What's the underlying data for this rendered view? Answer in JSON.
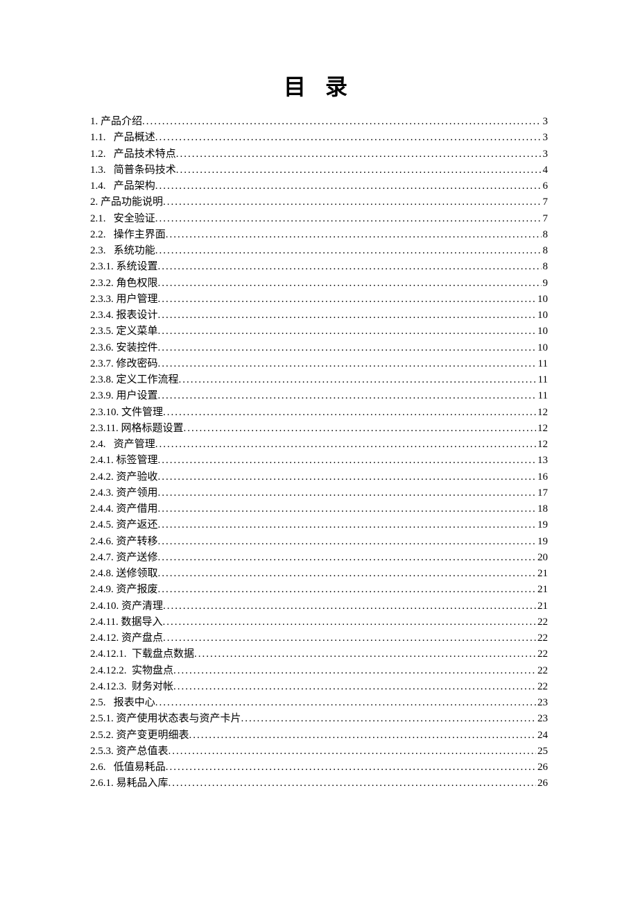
{
  "title": "目 录",
  "entries": [
    {
      "num": "1.",
      "text": "产品介绍",
      "page": "3",
      "indent": 0,
      "gap": " "
    },
    {
      "num": "1.1.",
      "text": "产品概述",
      "page": "3",
      "indent": 1,
      "gap": "   "
    },
    {
      "num": "1.2.",
      "text": "产品技术特点",
      "page": "3",
      "indent": 1,
      "gap": "   "
    },
    {
      "num": "1.3.",
      "text": "简普条码技术",
      "page": "4",
      "indent": 1,
      "gap": "   "
    },
    {
      "num": "1.4.",
      "text": "产品架构",
      "page": "6",
      "indent": 1,
      "gap": "   "
    },
    {
      "num": "2.",
      "text": "产品功能说明",
      "page": "7",
      "indent": 0,
      "gap": " "
    },
    {
      "num": "2.1.",
      "text": "安全验证",
      "page": "7",
      "indent": 1,
      "gap": "   "
    },
    {
      "num": "2.2.",
      "text": "操作主界面",
      "page": "8",
      "indent": 1,
      "gap": "   "
    },
    {
      "num": "2.3.",
      "text": "系统功能",
      "page": "8",
      "indent": 1,
      "gap": "   "
    },
    {
      "num": "2.3.1.",
      "text": "系统设置 ",
      "page": "8",
      "indent": 2,
      "gap": " "
    },
    {
      "num": "2.3.2.",
      "text": "角色权限 ",
      "page": "9",
      "indent": 2,
      "gap": " "
    },
    {
      "num": "2.3.3.",
      "text": "用户管理 ",
      "page": "10",
      "indent": 2,
      "gap": " "
    },
    {
      "num": "2.3.4.",
      "text": "报表设计 ",
      "page": "10",
      "indent": 2,
      "gap": " "
    },
    {
      "num": "2.3.5.",
      "text": "定义菜单 ",
      "page": "10",
      "indent": 2,
      "gap": " "
    },
    {
      "num": "2.3.6.",
      "text": "安装控件 ",
      "page": "10",
      "indent": 2,
      "gap": " "
    },
    {
      "num": "2.3.7.",
      "text": "修改密码 ",
      "page": "11",
      "indent": 2,
      "gap": " "
    },
    {
      "num": "2.3.8.",
      "text": "定义工作流程 ",
      "page": "11",
      "indent": 2,
      "gap": " "
    },
    {
      "num": "2.3.9.",
      "text": "用户设置 ",
      "page": "11",
      "indent": 2,
      "gap": " "
    },
    {
      "num": "2.3.10.",
      "text": "文件管理 ",
      "page": "12",
      "indent": 2,
      "gap": " "
    },
    {
      "num": "2.3.11.",
      "text": "网格标题设置 ",
      "page": "12",
      "indent": 2,
      "gap": " "
    },
    {
      "num": "2.4.",
      "text": "资产管理",
      "page": "12",
      "indent": 1,
      "gap": "   "
    },
    {
      "num": "2.4.1.",
      "text": "标签管理 ",
      "page": "13",
      "indent": 2,
      "gap": " "
    },
    {
      "num": "2.4.2.",
      "text": "资产验收 ",
      "page": "16",
      "indent": 2,
      "gap": " "
    },
    {
      "num": "2.4.3.",
      "text": "资产领用 ",
      "page": "17",
      "indent": 2,
      "gap": " "
    },
    {
      "num": "2.4.4.",
      "text": "资产借用 ",
      "page": "18",
      "indent": 2,
      "gap": " "
    },
    {
      "num": "2.4.5.",
      "text": "资产返还 ",
      "page": "19",
      "indent": 2,
      "gap": " "
    },
    {
      "num": "2.4.6.",
      "text": "资产转移 ",
      "page": "19",
      "indent": 2,
      "gap": " "
    },
    {
      "num": "2.4.7.",
      "text": "资产送修 ",
      "page": "20",
      "indent": 2,
      "gap": " "
    },
    {
      "num": "2.4.8.",
      "text": "送修领取 ",
      "page": "21",
      "indent": 2,
      "gap": " "
    },
    {
      "num": "2.4.9.",
      "text": "资产报废 ",
      "page": "21",
      "indent": 2,
      "gap": " "
    },
    {
      "num": "2.4.10.",
      "text": "资产清理 ",
      "page": "21",
      "indent": 2,
      "gap": " "
    },
    {
      "num": "2.4.11.",
      "text": "数据导入 ",
      "page": "22",
      "indent": 2,
      "gap": " "
    },
    {
      "num": "2.4.12.",
      "text": "资产盘点 ",
      "page": "22",
      "indent": 2,
      "gap": " "
    },
    {
      "num": "2.4.12.1.",
      "text": "下载盘点数据 ",
      "page": "22",
      "indent": 3,
      "gap": "  "
    },
    {
      "num": "2.4.12.2.",
      "text": "实物盘点 ",
      "page": "22",
      "indent": 3,
      "gap": "  "
    },
    {
      "num": "2.4.12.3.",
      "text": "财务对帐 ",
      "page": "22",
      "indent": 3,
      "gap": "  "
    },
    {
      "num": "2.5.",
      "text": "报表中心",
      "page": "23",
      "indent": 1,
      "gap": "   "
    },
    {
      "num": "2.5.1.",
      "text": "资产使用状态表与资产卡片 ",
      "page": "23",
      "indent": 2,
      "gap": " "
    },
    {
      "num": "2.5.2.",
      "text": "资产变更明细表 ",
      "page": "24",
      "indent": 2,
      "gap": " "
    },
    {
      "num": "2.5.3.",
      "text": "资产总值表 ",
      "page": "25",
      "indent": 2,
      "gap": " "
    },
    {
      "num": "2.6.",
      "text": "低值易耗品",
      "page": "26",
      "indent": 1,
      "gap": "   "
    },
    {
      "num": "2.6.1.",
      "text": "易耗品入库 ",
      "page": "26",
      "indent": 2,
      "gap": " "
    }
  ]
}
